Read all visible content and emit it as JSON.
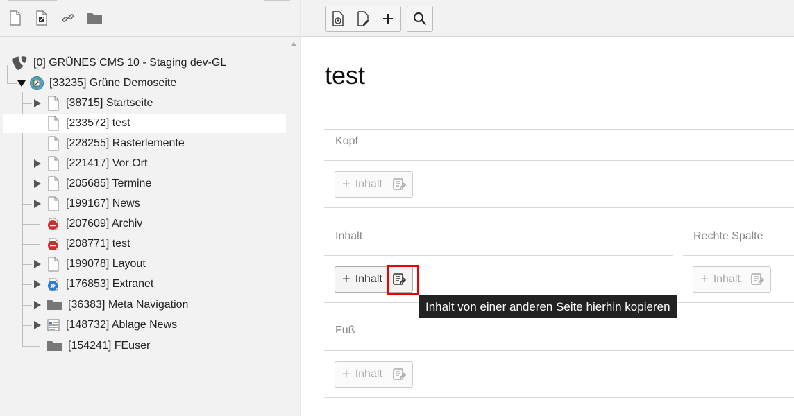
{
  "tree": {
    "root_label": "[0] GRÜNES CMS 10 - Staging dev-GL",
    "site_label": "[33235] Grüne Demoseite",
    "pages": [
      {
        "label": "[38715] Startseite"
      },
      {
        "label": "[233572] test"
      },
      {
        "label": "[228255] Rasterlemente"
      },
      {
        "label": "[221417] Vor Ort"
      },
      {
        "label": "[205685] Termine"
      },
      {
        "label": "[199167] News"
      },
      {
        "label": "[207609] Archiv"
      },
      {
        "label": "[208771] test"
      },
      {
        "label": "[199078] Layout"
      },
      {
        "label": "[176853] Extranet"
      },
      {
        "label": "[36383] Meta Navigation"
      },
      {
        "label": "[148732] Ablage News"
      },
      {
        "label": "[154241] FEuser"
      }
    ]
  },
  "content": {
    "page_title": "test",
    "columns": {
      "kopf": "Kopf",
      "inhalt": "Inhalt",
      "rechte_spalte": "Rechte Spalte",
      "fuss": "Fuß"
    },
    "add_label": "Inhalt",
    "tooltip": "Inhalt von einer anderen Seite hierhin kopieren"
  },
  "colors": {
    "highlight": "#ee0000",
    "tooltip_bg": "#222222",
    "typo3_orange": "#ff8700"
  }
}
